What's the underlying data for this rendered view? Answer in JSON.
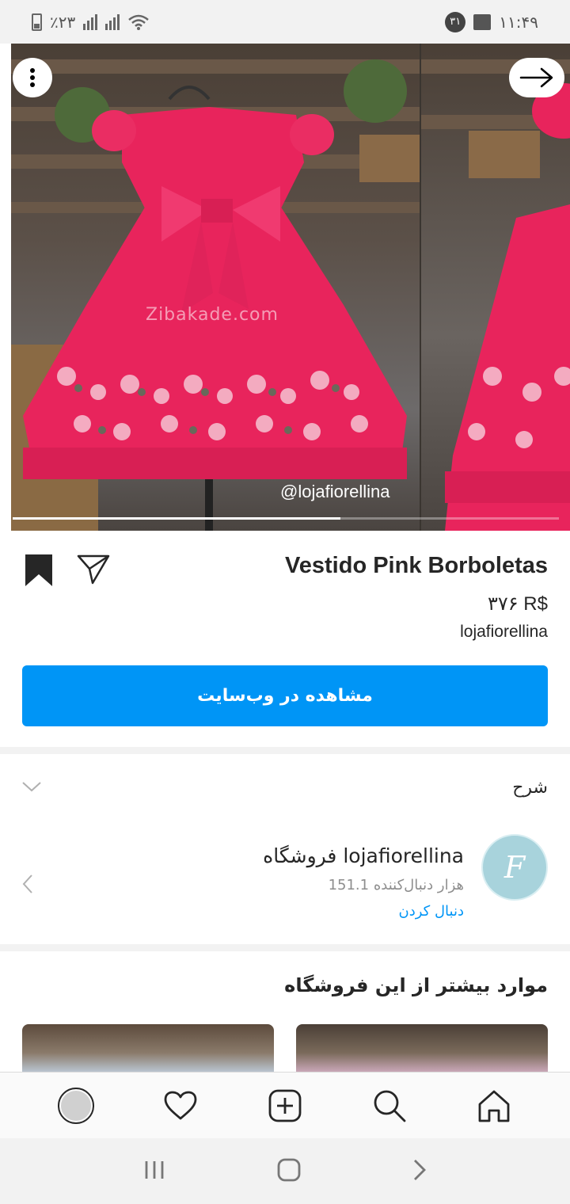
{
  "status_bar": {
    "battery_text": "٪۲۳",
    "time": "۱۱:۴۹",
    "notification_count": "۳۱"
  },
  "hero": {
    "handle": "@lojafiorellina",
    "watermark": "Zibakade.com",
    "image_progress": 0.6
  },
  "product": {
    "title": "Vestido Pink Borboletas",
    "price": "۳۷۶ R$",
    "merchant": "lojafiorellina",
    "cta_label": "مشاهده در وب‌سایت"
  },
  "description": {
    "label": "شرح"
  },
  "shop": {
    "name": "فروشگاه lojafiorellina",
    "followers": "151.1 هزار دنبال‌کننده",
    "follow_label": "دنبال کردن",
    "avatar_letter": "F"
  },
  "more": {
    "title": "موارد بیشتر از این فروشگاه"
  },
  "colors": {
    "accent": "#0095f6",
    "dress_pink": "#e8245c"
  }
}
